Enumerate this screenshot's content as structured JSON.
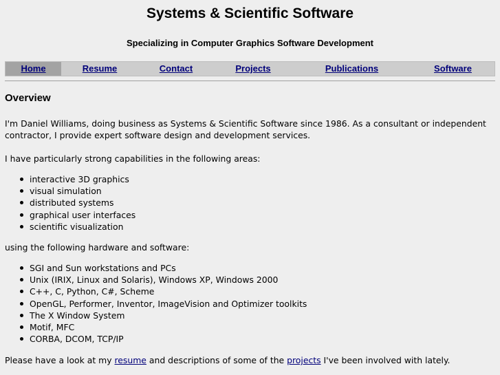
{
  "header": {
    "title": "Systems & Scientific Software",
    "tagline": "Specializing in Computer Graphics Software Development"
  },
  "nav": {
    "items": [
      {
        "label": "Home",
        "active": true
      },
      {
        "label": "Resume"
      },
      {
        "label": "Contact"
      },
      {
        "label": "Projects"
      },
      {
        "label": "Publications"
      },
      {
        "label": "Software"
      }
    ]
  },
  "main": {
    "heading": "Overview",
    "intro": "I'm Daniel Williams, doing business as Systems & Scientific Software since 1986. As a consultant or independent contractor, I provide expert software design and development services.",
    "areas_intro": "I have particularly strong capabilities in the following areas:",
    "areas": [
      "interactive 3D graphics",
      "visual simulation",
      "distributed systems",
      "graphical user interfaces",
      "scientific visualization"
    ],
    "hw_intro": "using the following hardware and software:",
    "hardware_software": [
      "SGI and Sun workstations and PCs",
      "Unix (IRIX, Linux and Solaris), Windows XP, Windows 2000",
      "C++, C, Python, C#, Scheme",
      "OpenGL, Performer, Inventor, ImageVision and Optimizer toolkits",
      "The X Window System",
      "Motif, MFC",
      "CORBA, DCOM, TCP/IP"
    ],
    "outro": {
      "before_resume": "Please have a look at my ",
      "resume_link": "resume",
      "between": " and descriptions of some of the ",
      "projects_link": "projects",
      "after": " I've been involved with lately."
    }
  }
}
